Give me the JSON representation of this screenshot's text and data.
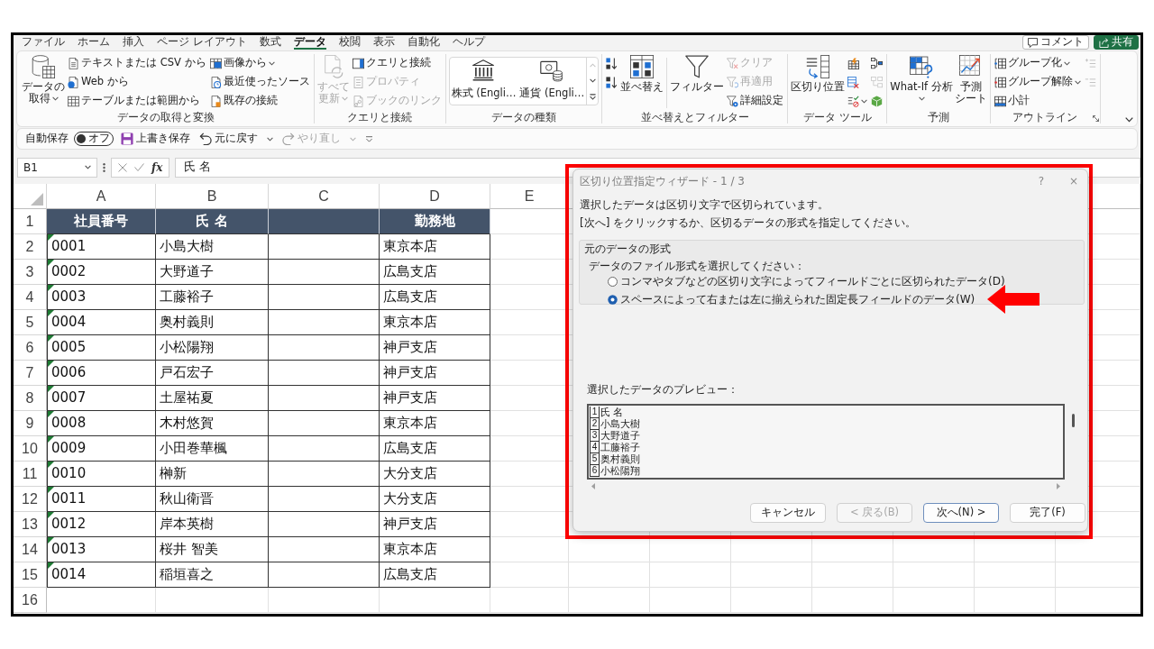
{
  "menu_tabs": [
    {
      "label": "ファイル",
      "selected": false
    },
    {
      "label": "ホーム",
      "selected": false
    },
    {
      "label": "挿入",
      "selected": false
    },
    {
      "label": "ページ レイアウト",
      "selected": false
    },
    {
      "label": "数式",
      "selected": false
    },
    {
      "label": "データ",
      "selected": true
    },
    {
      "label": "校閲",
      "selected": false
    },
    {
      "label": "表示",
      "selected": false
    },
    {
      "label": "自動化",
      "selected": false
    },
    {
      "label": "ヘルプ",
      "selected": false
    }
  ],
  "header_buttons": [
    {
      "kind": "outline",
      "label": "コメント"
    },
    {
      "kind": "primary",
      "label": "共有"
    }
  ],
  "ribbon": {
    "groups": [
      {
        "kind": "buttons",
        "label": "データの取得と変換",
        "columns": [
          {
            "kind": "stack",
            "items": [
              {
                "kind": "large",
                "lines": [
                  "データの",
                  "取得"
                ],
                "dropdown": true,
                "disabled": false
              }
            ]
          },
          {
            "kind": "stack",
            "items": [
              {
                "kind": "small",
                "label": "テキストまたは CSV から",
                "dropdown": false,
                "disabled": false
              },
              {
                "kind": "small",
                "label": "Web から",
                "dropdown": false,
                "disabled": false
              },
              {
                "kind": "small",
                "label": "テーブルまたは範囲から",
                "dropdown": false,
                "disabled": false
              }
            ]
          },
          {
            "kind": "stack",
            "items": [
              {
                "kind": "small",
                "label": "画像から",
                "dropdown": true,
                "disabled": false
              },
              {
                "kind": "small",
                "label": "最近使ったソース",
                "dropdown": false,
                "disabled": false
              },
              {
                "kind": "small",
                "label": "既存の接続",
                "dropdown": false,
                "disabled": false
              }
            ]
          }
        ]
      },
      {
        "kind": "buttons",
        "label": "クエリと接続",
        "columns": [
          {
            "kind": "stack",
            "items": [
              {
                "kind": "large",
                "lines": [
                  "すべて",
                  "更新"
                ],
                "dropdown": true,
                "disabled": true
              }
            ]
          },
          {
            "kind": "stack",
            "items": [
              {
                "kind": "small",
                "label": "クエリと接続",
                "dropdown": false,
                "disabled": false
              },
              {
                "kind": "small",
                "label": "プロパティ",
                "dropdown": false,
                "disabled": true
              },
              {
                "kind": "small",
                "label": "ブックのリンク",
                "dropdown": false,
                "disabled": true
              }
            ]
          }
        ]
      },
      {
        "kind": "gallery",
        "label": "データの種類",
        "items": [
          {
            "label": "株式 (Engli…"
          },
          {
            "label": "通貨 (Engli…"
          }
        ],
        "can_scroll_up": false,
        "can_scroll_down": true
      },
      {
        "kind": "buttons",
        "label": "並べ替えとフィルター",
        "columns": [
          {
            "kind": "stack",
            "items": [
              {
                "kind": "icon",
                "dropdown": false,
                "disabled": false
              },
              {
                "kind": "icon",
                "dropdown": false,
                "disabled": false
              }
            ]
          },
          {
            "kind": "stack",
            "items": [
              {
                "kind": "large",
                "lines": [
                  "並べ替え"
                ],
                "dropdown": false,
                "disabled": false
              }
            ]
          },
          {
            "kind": "separator"
          },
          {
            "kind": "stack",
            "items": [
              {
                "kind": "large",
                "lines": [
                  "フィルター"
                ],
                "dropdown": false,
                "disabled": false
              }
            ]
          },
          {
            "kind": "stack",
            "items": [
              {
                "kind": "small",
                "label": "クリア",
                "dropdown": false,
                "disabled": true
              },
              {
                "kind": "small",
                "label": "再適用",
                "dropdown": false,
                "disabled": true
              },
              {
                "kind": "small",
                "label": "詳細設定",
                "dropdown": false,
                "disabled": false
              }
            ]
          }
        ]
      },
      {
        "kind": "buttons",
        "label": "データ ツール",
        "columns": [
          {
            "kind": "stack",
            "items": [
              {
                "kind": "large",
                "lines": [
                  "区切り位置"
                ],
                "dropdown": false,
                "disabled": false
              }
            ]
          },
          {
            "kind": "stack",
            "items": [
              {
                "kind": "icon",
                "dropdown": false,
                "disabled": false
              },
              {
                "kind": "icon",
                "dropdown": false,
                "disabled": false
              },
              {
                "kind": "icon",
                "dropdown": true,
                "disabled": false
              }
            ]
          },
          {
            "kind": "stack",
            "items": [
              {
                "kind": "icon",
                "dropdown": false,
                "disabled": false
              },
              {
                "kind": "icon",
                "dropdown": false,
                "disabled": true
              },
              {
                "kind": "icon",
                "dropdown": false,
                "disabled": false
              }
            ]
          }
        ]
      },
      {
        "kind": "buttons",
        "label": "予測",
        "columns": [
          {
            "kind": "stack",
            "items": [
              {
                "kind": "large",
                "lines": [
                  "What-If 分析"
                ],
                "dropdown": true,
                "disabled": false
              }
            ]
          },
          {
            "kind": "stack",
            "items": [
              {
                "kind": "large",
                "lines": [
                  "予測",
                  "シート"
                ],
                "dropdown": false,
                "disabled": false
              }
            ]
          }
        ]
      },
      {
        "kind": "buttons",
        "label": "アウトライン",
        "launcher": true,
        "columns": [
          {
            "kind": "stack",
            "items": [
              {
                "kind": "small",
                "label": "グループ化",
                "dropdown": true,
                "disabled": false
              },
              {
                "kind": "small",
                "label": "グループ解除",
                "dropdown": true,
                "disabled": false
              },
              {
                "kind": "small",
                "label": "小計",
                "dropdown": false,
                "disabled": false
              }
            ]
          },
          {
            "kind": "stack",
            "items": [
              {
                "kind": "icon",
                "dropdown": false,
                "disabled": true
              },
              {
                "kind": "icon",
                "dropdown": false,
                "disabled": true
              }
            ]
          }
        ]
      }
    ]
  },
  "quick_access": {
    "autosave": {
      "label": "自動保存",
      "state_label": "オフ",
      "on": false
    },
    "buttons": [
      {
        "label": "上書き保存",
        "dropdown": false,
        "disabled": false
      },
      {
        "label": "元に戻す",
        "dropdown": true,
        "disabled": false
      },
      {
        "label": "やり直し",
        "dropdown": true,
        "disabled": true
      }
    ]
  },
  "formula_bar": {
    "name_box": "B1",
    "function_button": "fx",
    "formula": "氏 名"
  },
  "sheet": {
    "columns": [
      "A",
      "B",
      "C",
      "D",
      "E"
    ],
    "rows": [
      {
        "number": "1",
        "kind": "header",
        "id": "社員番号",
        "name": "氏 名",
        "office": "勤務地"
      },
      {
        "number": "2",
        "kind": "data",
        "id": "0001",
        "name": "小島大樹",
        "office": "東京本店",
        "flagged": true
      },
      {
        "number": "3",
        "kind": "data",
        "id": "0002",
        "name": "大野道子",
        "office": "広島支店",
        "flagged": true
      },
      {
        "number": "4",
        "kind": "data",
        "id": "0003",
        "name": "工藤裕子",
        "office": "広島支店",
        "flagged": true
      },
      {
        "number": "5",
        "kind": "data",
        "id": "0004",
        "name": "奥村義則",
        "office": "東京本店",
        "flagged": true
      },
      {
        "number": "6",
        "kind": "data",
        "id": "0005",
        "name": "小松陽翔",
        "office": "神戸支店",
        "flagged": true
      },
      {
        "number": "7",
        "kind": "data",
        "id": "0006",
        "name": "戸石宏子",
        "office": "神戸支店",
        "flagged": true
      },
      {
        "number": "8",
        "kind": "data",
        "id": "0007",
        "name": "土屋祐夏",
        "office": "神戸支店",
        "flagged": true
      },
      {
        "number": "9",
        "kind": "data",
        "id": "0008",
        "name": "木村悠賀",
        "office": "東京本店",
        "flagged": true
      },
      {
        "number": "10",
        "kind": "data",
        "id": "0009",
        "name": "小田巻華楓",
        "office": "広島支店",
        "flagged": true
      },
      {
        "number": "11",
        "kind": "data",
        "id": "0010",
        "name": "榊新",
        "office": "大分支店",
        "flagged": true
      },
      {
        "number": "12",
        "kind": "data",
        "id": "0011",
        "name": "秋山衛晋",
        "office": "大分支店",
        "flagged": true
      },
      {
        "number": "13",
        "kind": "data",
        "id": "0012",
        "name": "岸本英樹",
        "office": "神戸支店",
        "flagged": true
      },
      {
        "number": "14",
        "kind": "data",
        "id": "0013",
        "name": "桜井 智美",
        "office": "東京本店",
        "flagged": true
      },
      {
        "number": "15",
        "kind": "data",
        "id": "0014",
        "name": "稲垣喜之",
        "office": "広島支店",
        "flagged": true
      },
      {
        "number": "16",
        "kind": "empty"
      }
    ]
  },
  "dialog": {
    "outlined": true,
    "title": "区切り位置指定ウィザード - 1 / 3",
    "help_button": "?",
    "close_button": "×",
    "messages": [
      "選択したデータは区切り文字で区切られています。",
      "[次へ] をクリックするか、区切るデータの形式を指定してください。"
    ],
    "format_group": {
      "legend": "元のデータの形式",
      "prompt": "データのファイル形式を選択してください：",
      "options": [
        {
          "label": "コンマやタブなどの区切り文字によってフィールドごとに区切られたデータ(D)",
          "selected": false,
          "marked": false
        },
        {
          "label": "スペースによって右または左に揃えられた固定長フィールドのデータ(W)",
          "selected": true,
          "marked": true
        }
      ]
    },
    "preview_label": "選択したデータのプレビュー：",
    "preview_rows": [
      {
        "number": "1",
        "text": "氏 名"
      },
      {
        "number": "2",
        "text": "小島大樹"
      },
      {
        "number": "3",
        "text": "大野道子"
      },
      {
        "number": "4",
        "text": "工藤裕子"
      },
      {
        "number": "5",
        "text": "奥村義則"
      },
      {
        "number": "6",
        "text": "小松陽翔"
      }
    ],
    "buttons": [
      {
        "label": "キャンセル",
        "disabled": false,
        "default": false
      },
      {
        "label": "< 戻る(B)",
        "disabled": true,
        "default": false
      },
      {
        "label": "次へ(N) >",
        "disabled": false,
        "default": true
      },
      {
        "label": "完了(F)",
        "disabled": false,
        "default": false
      }
    ]
  }
}
